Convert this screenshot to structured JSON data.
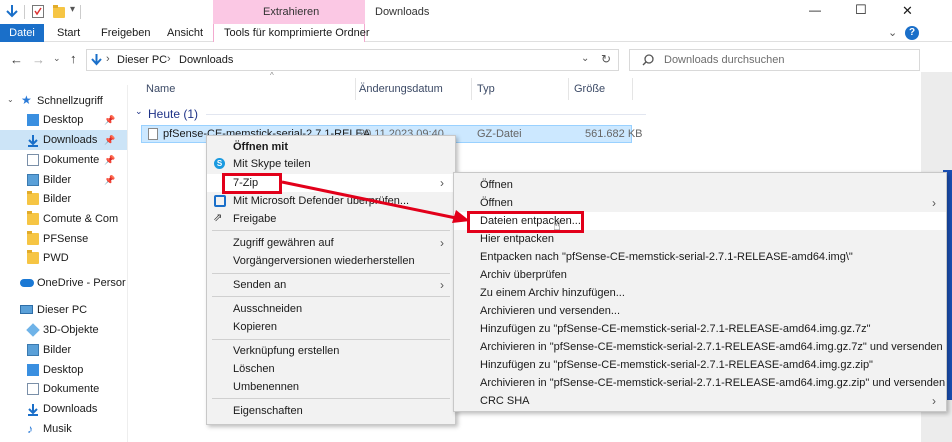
{
  "window": {
    "title": "Downloads",
    "context_tab": "Extrahieren",
    "controls": {
      "minimize": "—",
      "maximize": "☐",
      "close": "✕"
    }
  },
  "ribbon": {
    "tabs": [
      "Datei",
      "Start",
      "Freigeben",
      "Ansicht",
      "Tools für komprimierte Ordner"
    ]
  },
  "address": {
    "crumbs": [
      "Dieser PC",
      "Downloads"
    ],
    "search_placeholder": "Downloads durchsuchen"
  },
  "nav": {
    "quick_access": "Schnellzugriff",
    "items": [
      {
        "label": "Desktop",
        "pinned": true
      },
      {
        "label": "Downloads",
        "pinned": true
      },
      {
        "label": "Dokumente",
        "pinned": true
      },
      {
        "label": "Bilder",
        "pinned": true
      },
      {
        "label": "Bilder"
      },
      {
        "label": "Comute & Com"
      },
      {
        "label": "PFSense"
      },
      {
        "label": "PWD"
      }
    ],
    "onedrive": "OneDrive - Persor",
    "this_pc": "Dieser PC",
    "pc_items": [
      "3D-Objekte",
      "Bilder",
      "Desktop",
      "Dokumente",
      "Downloads",
      "Musik"
    ]
  },
  "columns": {
    "name": "Name",
    "date": "Änderungsdatum",
    "type": "Typ",
    "size": "Größe"
  },
  "group": {
    "label": "Heute (1)"
  },
  "file": {
    "name": "pfSense-CE-memstick-serial-2.7.1-RELEA",
    "date": "20.11.2023 09:40",
    "type": "GZ-Datei",
    "size": "561.682 KB"
  },
  "context_menu": {
    "open_with": "Öffnen mit",
    "skype": "Mit Skype teilen",
    "seven_zip": "7-Zip",
    "defender": "Mit Microsoft Defender überprüfen...",
    "share": "Freigabe",
    "grant_access": "Zugriff gewähren auf",
    "prev_versions": "Vorgängerversionen wiederherstellen",
    "send_to": "Senden an",
    "cut": "Ausschneiden",
    "copy": "Kopieren",
    "create_shortcut": "Verknüpfung erstellen",
    "delete": "Löschen",
    "rename": "Umbenennen",
    "properties": "Eigenschaften"
  },
  "submenu": {
    "items": [
      "Öffnen",
      "Öffnen",
      "Dateien entpacken...",
      "Hier entpacken",
      "Entpacken nach \"pfSense-CE-memstick-serial-2.7.1-RELEASE-amd64.img\\\"",
      "Archiv überprüfen",
      "Zu einem Archiv hinzufügen...",
      "Archivieren und versenden...",
      "Hinzufügen zu \"pfSense-CE-memstick-serial-2.7.1-RELEASE-amd64.img.gz.7z\"",
      "Archivieren in \"pfSense-CE-memstick-serial-2.7.1-RELEASE-amd64.img.gz.7z\" und versenden",
      "Hinzufügen zu \"pfSense-CE-memstick-serial-2.7.1-RELEASE-amd64.img.gz.zip\"",
      "Archivieren in \"pfSense-CE-memstick-serial-2.7.1-RELEASE-amd64.img.gz.zip\" und versenden",
      "CRC SHA"
    ]
  },
  "colors": {
    "accent": "#1a6fc9",
    "highlight": "#e2001a",
    "tab_pink": "#fbc8e4"
  }
}
